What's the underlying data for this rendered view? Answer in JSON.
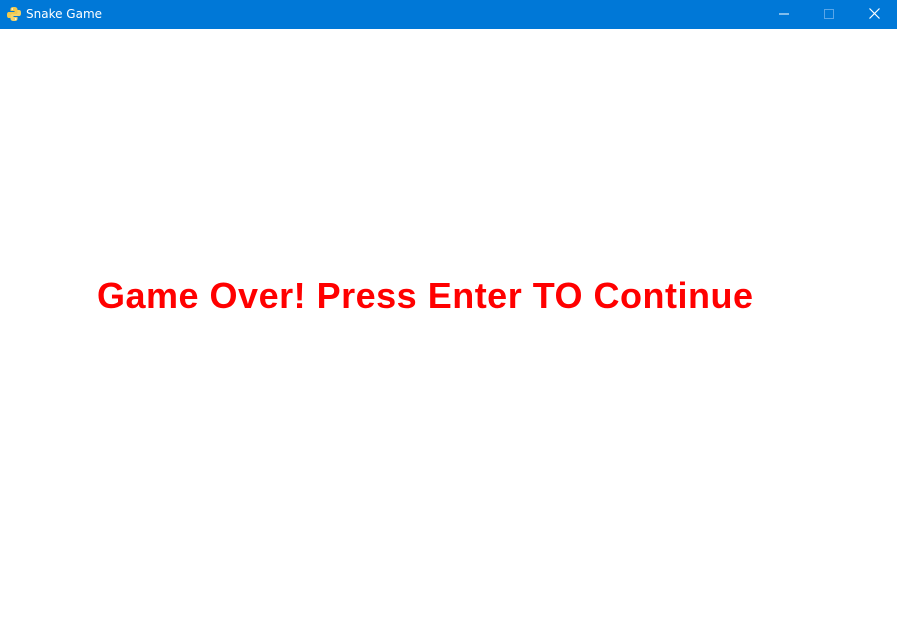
{
  "window": {
    "title": "Snake Game",
    "app_icon": "python-icon",
    "controls": {
      "minimize_icon": "minimize-icon",
      "maximize_icon": "maximize-icon",
      "close_icon": "close-icon"
    },
    "titlebar_color": "#0078d7"
  },
  "game": {
    "message": "Game Over! Press Enter TO Continue",
    "message_color": "#ff0000",
    "background_color": "#ffffff"
  }
}
